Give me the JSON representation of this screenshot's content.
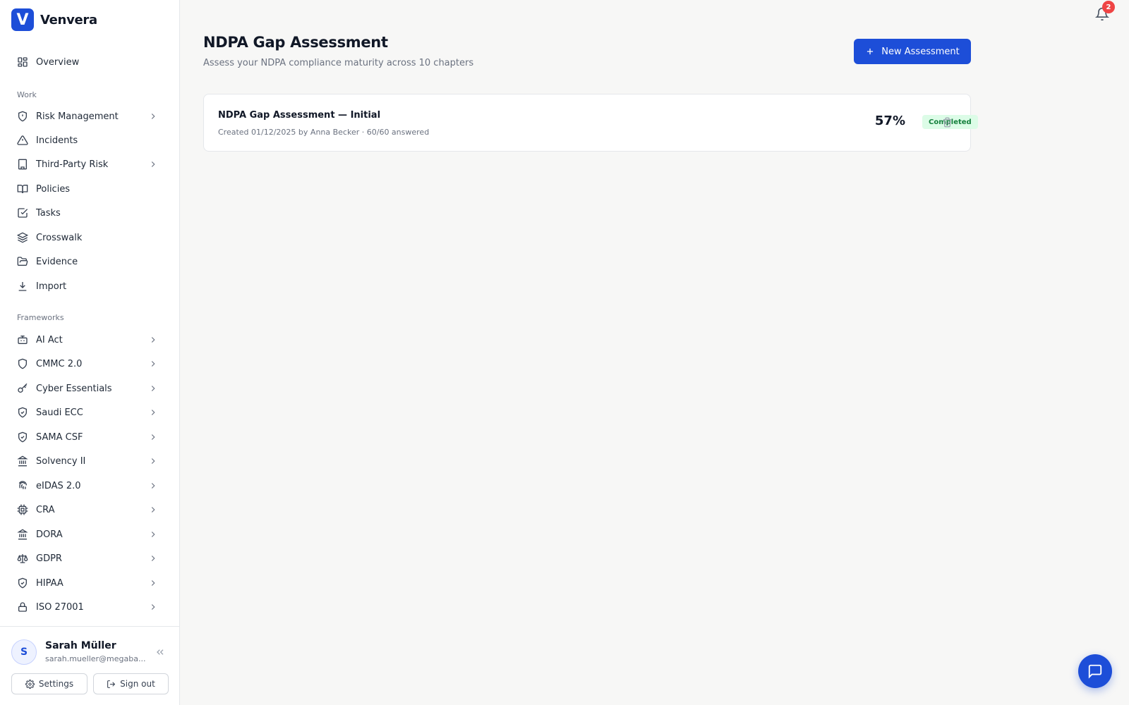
{
  "brand": {
    "name": "Venvera",
    "logo_letter": "V"
  },
  "sidebar": {
    "overview": {
      "label": "Overview",
      "icon": "layout-grid-icon"
    },
    "work_section": "Work",
    "work_items": [
      {
        "label": "Risk Management",
        "icon": "shield-alert-icon",
        "has_submenu": true
      },
      {
        "label": "Incidents",
        "icon": "warning-triangle-icon",
        "has_submenu": false
      },
      {
        "label": "Third-Party Risk",
        "icon": "building-icon",
        "has_submenu": true
      },
      {
        "label": "Policies",
        "icon": "book-open-icon",
        "has_submenu": false
      },
      {
        "label": "Tasks",
        "icon": "check-square-icon",
        "has_submenu": false
      },
      {
        "label": "Crosswalk",
        "icon": "layers-icon",
        "has_submenu": false
      },
      {
        "label": "Evidence",
        "icon": "folder-open-icon",
        "has_submenu": false
      },
      {
        "label": "Import",
        "icon": "download-icon",
        "has_submenu": false
      }
    ],
    "frameworks_section": "Frameworks",
    "framework_items": [
      {
        "label": "AI Act",
        "icon": "bot-icon"
      },
      {
        "label": "CMMC 2.0",
        "icon": "shield-icon"
      },
      {
        "label": "Cyber Essentials",
        "icon": "key-icon"
      },
      {
        "label": "Saudi ECC",
        "icon": "shield-check-icon"
      },
      {
        "label": "SAMA CSF",
        "icon": "shield-check-icon"
      },
      {
        "label": "Solvency II",
        "icon": "landmark-icon"
      },
      {
        "label": "eIDAS 2.0",
        "icon": "fingerprint-icon"
      },
      {
        "label": "CRA",
        "icon": "cpu-icon"
      },
      {
        "label": "DORA",
        "icon": "landmark-icon"
      },
      {
        "label": "GDPR",
        "icon": "scale-icon"
      },
      {
        "label": "HIPAA",
        "icon": "shield-check-icon"
      },
      {
        "label": "ISO 27001",
        "icon": "lock-icon"
      }
    ]
  },
  "user": {
    "initial": "S",
    "name": "Sarah Müller",
    "email": "sarah.mueller@megaba...",
    "settings_label": "Settings",
    "signout_label": "Sign out"
  },
  "main": {
    "title": "NDPA Gap Assessment",
    "subtitle": "Assess your NDPA compliance maturity across 10 chapters",
    "new_button_label": "New Assessment",
    "assessments": [
      {
        "title": "NDPA Gap Assessment — Initial",
        "meta": "Created 01/12/2025 by Anna Becker · 60/60 answered",
        "score": "57%",
        "status": "Completed"
      }
    ]
  },
  "notifications": {
    "count": "2"
  },
  "colors": {
    "primary": "#1d4ed8",
    "success_bg": "#dcfce7",
    "success_text": "#15803d",
    "alert": "#ef4444"
  }
}
